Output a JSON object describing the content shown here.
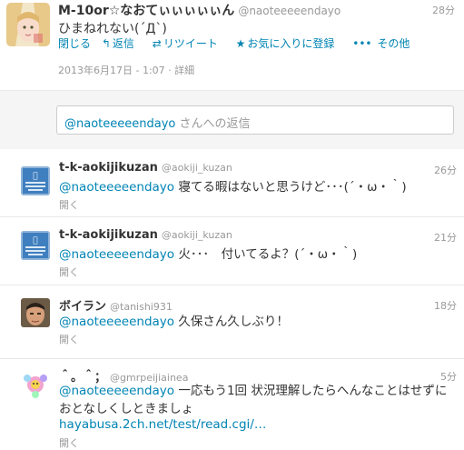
{
  "top_tweet": {
    "name": "M-10or☆なおてぃぃぃぃぃん",
    "handle": "@naoteeeeendayo",
    "time": "28分",
    "text": "ひまねれない(´Д`)",
    "actions": {
      "close": "閉じる",
      "reply": "返信",
      "retweet": "リツイート",
      "favorite": "お気に入りに登録",
      "more": "その他"
    },
    "date": "2013年6月17日 - 1:07",
    "details": "詳細"
  },
  "reply_box": {
    "handle": "@naoteeeeendayo",
    "suffix": " さんへの返信"
  },
  "replies": [
    {
      "name": "t-k-aokijikuzan",
      "handle": "@aokiji_kuzan",
      "time": "26分",
      "mention": "@naoteeeeendayo",
      "text": " 寝てる暇はないと思うけど･･･(´・ω・｀)",
      "open": "開く"
    },
    {
      "name": "t-k-aokijikuzan",
      "handle": "@aokiji_kuzan",
      "time": "21分",
      "mention": "@naoteeeeendayo",
      "text": " 火･･･　付いてるよ？(´・ω・｀)",
      "open": "開く"
    },
    {
      "name": "ボイラン",
      "handle": "@tanishi931",
      "time": "18分",
      "mention": "@naoteeeeendayo",
      "text": " 久保さん久しぶり！",
      "open": "開く"
    },
    {
      "name": "＾。＾；",
      "handle": "@gmrpeijiainea",
      "time": "5分",
      "mention": "@naoteeeeendayo",
      "text": " 一応もう1回 状況理解したらへんなことはせずにおとなしくしときましょ",
      "link": "hayabusa.2ch.net/test/read.cgi/…",
      "open": "開く"
    }
  ],
  "colors": {
    "link": "#0084b4",
    "muted": "#999999",
    "text": "#333333"
  }
}
